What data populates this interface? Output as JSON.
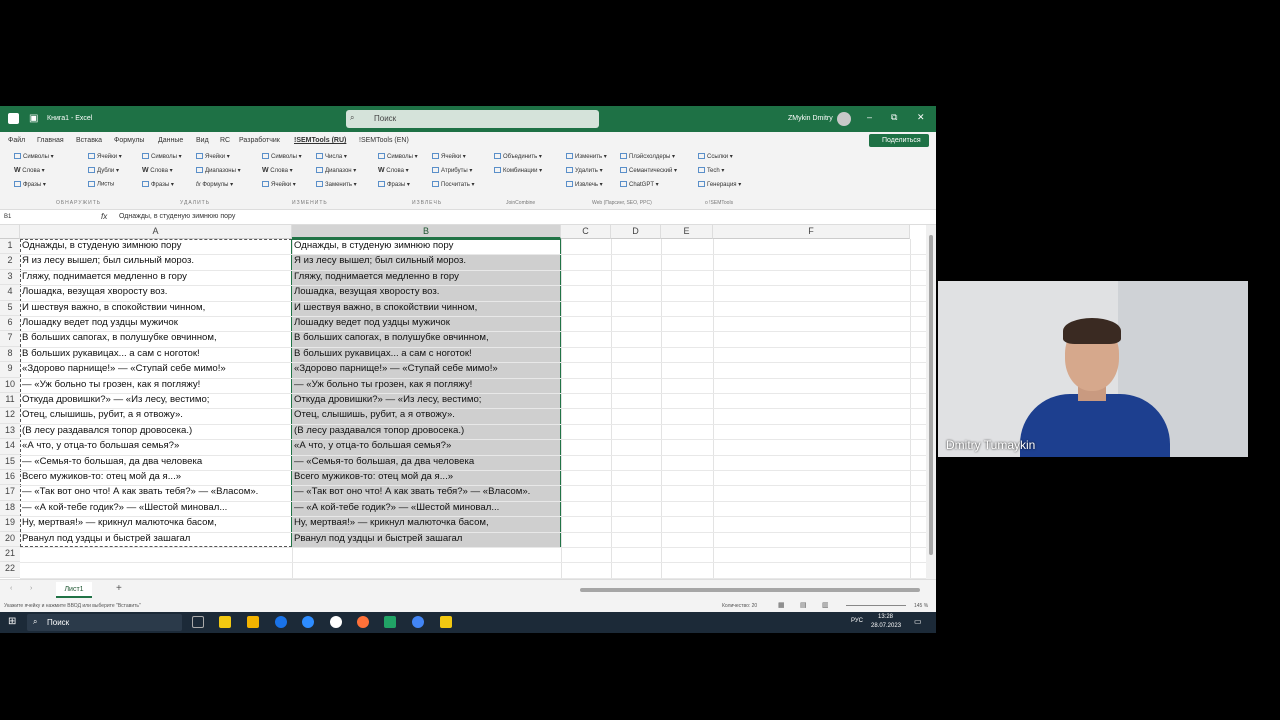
{
  "titlebar": {
    "doc_name": "Книга1 - Excel",
    "search_placeholder": "Поиск",
    "user": "ZMykin Dmitry",
    "minimize": "–",
    "restore": "⧉",
    "close": "✕"
  },
  "menu": {
    "tabs": [
      "Файл",
      "Главная",
      "Вставка",
      "Формулы",
      "Данные",
      "Вид",
      "RC",
      "Разработчик",
      "!SEMTools (RU)",
      "!SEMTools (EN)"
    ],
    "active": "!SEMTools (RU)",
    "share": "Поделиться"
  },
  "ribbon": {
    "items": [
      [
        "Символы ▾",
        "Слова ▾",
        "Фразы ▾"
      ],
      [
        "Ячейки ▾",
        "Дубли ▾",
        "Листы"
      ],
      [
        "Символы ▾",
        "Слова ▾",
        "Фразы ▾"
      ],
      [
        "Ячейки ▾",
        "Диапазоны ▾",
        "Формулы ▾"
      ],
      [
        "Символы ▾",
        "Слова ▾",
        "Ячейки ▾"
      ],
      [
        "Числа ▾",
        "Диапазон ▾",
        "Заменить ▾"
      ],
      [
        "Символы ▾",
        "Слова ▾",
        "Фразы ▾"
      ],
      [
        "Ячейки ▾",
        "Атрибуты ▾",
        "Посчитать ▾"
      ],
      [
        "Объединить ▾",
        "Комбинации ▾",
        ""
      ],
      [
        "Изменить ▾",
        "Удалить ▾",
        "Извлечь ▾"
      ],
      [
        "Плэйсхолдеры ▾",
        "Семантический ▾",
        "ChatGPT ▾"
      ],
      [
        "Ссылки ▾",
        "Tech ▾",
        "Генерация ▾"
      ]
    ],
    "groups": [
      "ОБНАРУЖИТЬ",
      "УДАЛИТЬ",
      "ИЗМЕНИТЬ",
      "ИЗВЛЕЧЬ",
      "JoinCombine",
      "Web (Парсинг, SEO, PPC)",
      "о !SEMTools"
    ]
  },
  "formula_bar": {
    "name_box": "B1",
    "fx": "fx",
    "formula": "Однажды, в студеную зимнюю пору"
  },
  "columns": [
    "A",
    "B",
    "C",
    "D",
    "E",
    "F"
  ],
  "rows": [
    "1",
    "2",
    "3",
    "4",
    "5",
    "6",
    "7",
    "8",
    "9",
    "10",
    "11",
    "12",
    "13",
    "14",
    "15",
    "16",
    "17",
    "18",
    "19",
    "20",
    "21",
    "22"
  ],
  "col_a": [
    "Однажды, в студеную зимнюю пору",
    "Я из лесу вышел; был сильный мороз.",
    "Гляжу, поднимается медленно в гору",
    "Лошадка, везущая хворосту воз.",
    "И шествуя важно, в спокойствии чинном,",
    "Лошадку ведет под уздцы мужичок",
    "В больших сапогах, в полушубке овчинном,",
    "В больших рукавицах... а сам с ноготок!",
    "«Здорово парнище!» — «Ступай себе мимо!»",
    "— «Уж больно ты грозен, как я погляжу!",
    "Откуда дровишки?» — «Из лесу, вестимо;",
    "Отец, слышишь, рубит, а я отвожу».",
    "(В лесу раздавался топор дровосека.)",
    "«А что, у отца-то большая семья?»",
    "— «Семья-то большая, да два человека",
    "Всего мужиков-то: отец мой да я...»",
    "— «Так вот оно что! А как звать тебя?» — «Власом».",
    "— «А кой-тебе годик?» — «Шестой миновал...",
    "Ну, мертвая!» — крикнул малюточка басом,",
    "Рванул под уздцы и быстрей зашагал"
  ],
  "col_b": [
    "Однажды, в студеную зимнюю пору",
    "Я из лесу вышел; был сильный мороз.",
    "Гляжу, поднимается медленно в гору",
    "Лошадка, везущая хворосту воз.",
    "И шествуя важно, в спокойствии чинном,",
    "Лошадку ведет под уздцы мужичок",
    "В больших сапогах, в полушубке овчинном,",
    "В больших рукавицах... а сам с ноготок!",
    "«Здорово парнище!» — «Ступай себе мимо!»",
    "— «Уж больно ты грозен, как я погляжу!",
    "Откуда дровишки?» — «Из лесу, вестимо;",
    "Отец, слышишь, рубит, а я отвожу».",
    "(В лесу раздавался топор дровосека.)",
    "«А что, у отца-то большая семья?»",
    "— «Семья-то большая, да два человека",
    "Всего мужиков-то: отец мой да я...»",
    "— «Так вот оно что! А как звать тебя?» — «Власом».",
    "— «А кой-тебе годик?» — «Шестой миновал...",
    "Ну, мертвая!» — крикнул малюточка басом,",
    "Рванул под уздцы и быстрей зашагал"
  ],
  "sheet_tab": "Лист1",
  "add_sheet": "+",
  "status": {
    "left": "Укажите ячейку и нажмите ВВОД или выберите \"Вставить\"",
    "count": "Количество: 20",
    "zoom": "145 %"
  },
  "taskbar": {
    "search": "Поиск",
    "lang": "РУС",
    "time": "13:28",
    "date": "28.07.2023"
  },
  "webcam": {
    "name": "Dmitry Tumaykin"
  },
  "colors": {
    "excel_green": "#1e7145",
    "selection_gray": "#cfcfcf"
  }
}
